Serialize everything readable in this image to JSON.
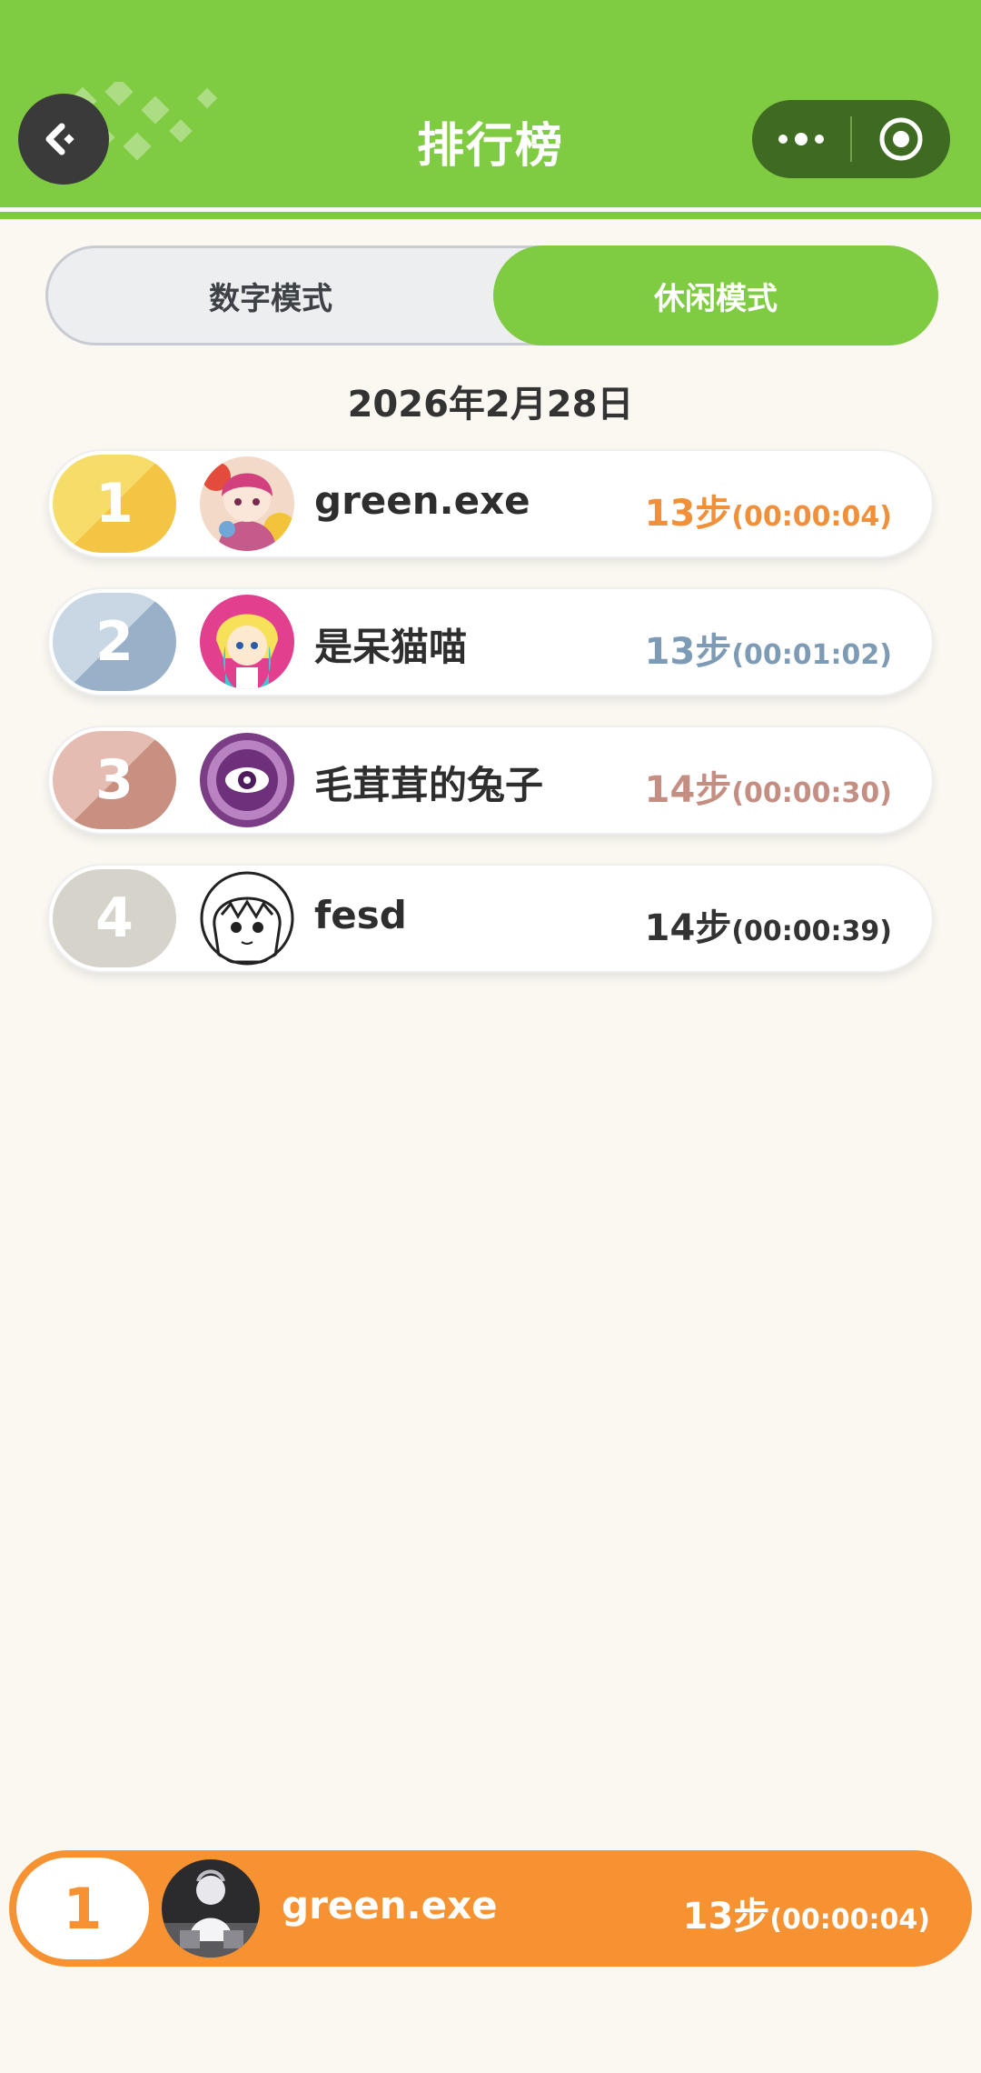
{
  "header": {
    "title": "排行榜",
    "accent": "#7fcb42"
  },
  "tabs": [
    {
      "label": "数字模式",
      "active": false
    },
    {
      "label": "休闲模式",
      "active": true
    }
  ],
  "date": "2026年2月28日",
  "ranking": [
    {
      "rank": "1",
      "name": "green.exe",
      "steps": "13步",
      "time": "(00:00:04)",
      "color": "#f0903a"
    },
    {
      "rank": "2",
      "name": "是呆猫喵",
      "steps": "13步",
      "time": "(00:01:02)",
      "color": "#7e9bb5"
    },
    {
      "rank": "3",
      "name": "毛茸茸的兔子",
      "steps": "14步",
      "time": "(00:00:30)",
      "color": "#c48e82"
    },
    {
      "rank": "4",
      "name": "fesd",
      "steps": "14步",
      "time": "(00:00:39)",
      "color": "#333333"
    }
  ],
  "me": {
    "rank": "1",
    "name": "green.exe",
    "steps": "13步",
    "time": "(00:00:04)",
    "color": "#f69232"
  }
}
